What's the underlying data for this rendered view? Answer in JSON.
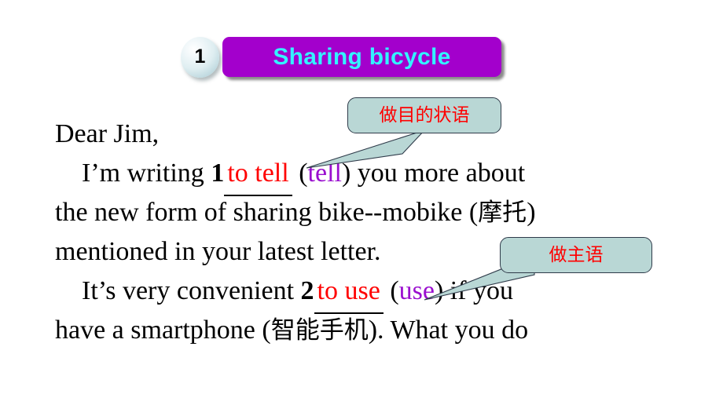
{
  "header": {
    "number": "1",
    "title": "Sharing bicycle"
  },
  "colors": {
    "title_box": "#a300cc",
    "title_text": "#33f3ff",
    "answer_red": "#ff0000",
    "cue_purple": "#9a0fcf",
    "callout_fill": "#b9d7d5",
    "callout_border": "#2f3b4a",
    "background": "#ffffff"
  },
  "body": {
    "lines": [
      {
        "id": "line-salutation",
        "segments": [
          {
            "type": "text",
            "text": "Dear Jim,"
          }
        ]
      },
      {
        "id": "line-1",
        "segments": [
          {
            "type": "indent"
          },
          {
            "type": "text",
            "text": "I’m writing "
          },
          {
            "type": "bold",
            "text": "1"
          },
          {
            "type": "blank",
            "text": "to tell"
          },
          {
            "type": "text",
            "text": " ("
          },
          {
            "type": "cue",
            "text": "tell"
          },
          {
            "type": "text",
            "text": ") you more about"
          }
        ]
      },
      {
        "id": "line-2",
        "segments": [
          {
            "type": "text",
            "text": "the new form of sharing bike--mobike ("
          },
          {
            "type": "cn",
            "text": "摩托"
          },
          {
            "type": "text",
            "text": ")"
          }
        ]
      },
      {
        "id": "line-3",
        "segments": [
          {
            "type": "text",
            "text": "mentioned in your latest letter."
          }
        ]
      },
      {
        "id": "line-4",
        "segments": [
          {
            "type": "indent"
          },
          {
            "type": "text",
            "text": "It’s very convenient "
          },
          {
            "type": "bold",
            "text": "2"
          },
          {
            "type": "blank",
            "text": "to use"
          },
          {
            "type": "text",
            "text": " ("
          },
          {
            "type": "cue",
            "text": "use"
          },
          {
            "type": "text",
            "text": ") if you"
          }
        ]
      },
      {
        "id": "line-5",
        "segments": [
          {
            "type": "text",
            "text": "have a smartphone ("
          },
          {
            "type": "cn",
            "text": "智能手机"
          },
          {
            "type": "text",
            "text": ").  What you do"
          }
        ]
      }
    ]
  },
  "callouts": [
    {
      "id": "callout-1",
      "label": "做目的状语",
      "points_to": "to tell"
    },
    {
      "id": "callout-2",
      "label": "做主语",
      "points_to": "to use"
    }
  ]
}
